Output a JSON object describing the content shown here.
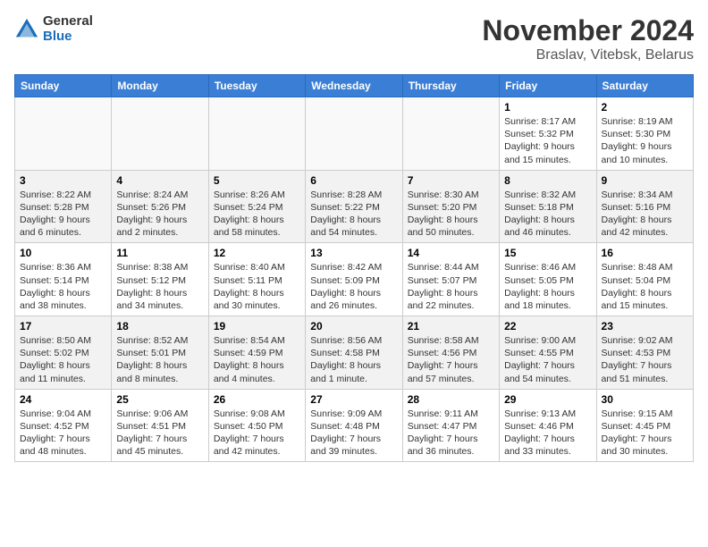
{
  "header": {
    "logo_general": "General",
    "logo_blue": "Blue",
    "month_title": "November 2024",
    "location": "Braslav, Vitebsk, Belarus"
  },
  "days_of_week": [
    "Sunday",
    "Monday",
    "Tuesday",
    "Wednesday",
    "Thursday",
    "Friday",
    "Saturday"
  ],
  "weeks": [
    {
      "shaded": false,
      "days": [
        {
          "num": "",
          "info": ""
        },
        {
          "num": "",
          "info": ""
        },
        {
          "num": "",
          "info": ""
        },
        {
          "num": "",
          "info": ""
        },
        {
          "num": "",
          "info": ""
        },
        {
          "num": "1",
          "info": "Sunrise: 8:17 AM\nSunset: 5:32 PM\nDaylight: 9 hours\nand 15 minutes."
        },
        {
          "num": "2",
          "info": "Sunrise: 8:19 AM\nSunset: 5:30 PM\nDaylight: 9 hours\nand 10 minutes."
        }
      ]
    },
    {
      "shaded": true,
      "days": [
        {
          "num": "3",
          "info": "Sunrise: 8:22 AM\nSunset: 5:28 PM\nDaylight: 9 hours\nand 6 minutes."
        },
        {
          "num": "4",
          "info": "Sunrise: 8:24 AM\nSunset: 5:26 PM\nDaylight: 9 hours\nand 2 minutes."
        },
        {
          "num": "5",
          "info": "Sunrise: 8:26 AM\nSunset: 5:24 PM\nDaylight: 8 hours\nand 58 minutes."
        },
        {
          "num": "6",
          "info": "Sunrise: 8:28 AM\nSunset: 5:22 PM\nDaylight: 8 hours\nand 54 minutes."
        },
        {
          "num": "7",
          "info": "Sunrise: 8:30 AM\nSunset: 5:20 PM\nDaylight: 8 hours\nand 50 minutes."
        },
        {
          "num": "8",
          "info": "Sunrise: 8:32 AM\nSunset: 5:18 PM\nDaylight: 8 hours\nand 46 minutes."
        },
        {
          "num": "9",
          "info": "Sunrise: 8:34 AM\nSunset: 5:16 PM\nDaylight: 8 hours\nand 42 minutes."
        }
      ]
    },
    {
      "shaded": false,
      "days": [
        {
          "num": "10",
          "info": "Sunrise: 8:36 AM\nSunset: 5:14 PM\nDaylight: 8 hours\nand 38 minutes."
        },
        {
          "num": "11",
          "info": "Sunrise: 8:38 AM\nSunset: 5:12 PM\nDaylight: 8 hours\nand 34 minutes."
        },
        {
          "num": "12",
          "info": "Sunrise: 8:40 AM\nSunset: 5:11 PM\nDaylight: 8 hours\nand 30 minutes."
        },
        {
          "num": "13",
          "info": "Sunrise: 8:42 AM\nSunset: 5:09 PM\nDaylight: 8 hours\nand 26 minutes."
        },
        {
          "num": "14",
          "info": "Sunrise: 8:44 AM\nSunset: 5:07 PM\nDaylight: 8 hours\nand 22 minutes."
        },
        {
          "num": "15",
          "info": "Sunrise: 8:46 AM\nSunset: 5:05 PM\nDaylight: 8 hours\nand 18 minutes."
        },
        {
          "num": "16",
          "info": "Sunrise: 8:48 AM\nSunset: 5:04 PM\nDaylight: 8 hours\nand 15 minutes."
        }
      ]
    },
    {
      "shaded": true,
      "days": [
        {
          "num": "17",
          "info": "Sunrise: 8:50 AM\nSunset: 5:02 PM\nDaylight: 8 hours\nand 11 minutes."
        },
        {
          "num": "18",
          "info": "Sunrise: 8:52 AM\nSunset: 5:01 PM\nDaylight: 8 hours\nand 8 minutes."
        },
        {
          "num": "19",
          "info": "Sunrise: 8:54 AM\nSunset: 4:59 PM\nDaylight: 8 hours\nand 4 minutes."
        },
        {
          "num": "20",
          "info": "Sunrise: 8:56 AM\nSunset: 4:58 PM\nDaylight: 8 hours\nand 1 minute."
        },
        {
          "num": "21",
          "info": "Sunrise: 8:58 AM\nSunset: 4:56 PM\nDaylight: 7 hours\nand 57 minutes."
        },
        {
          "num": "22",
          "info": "Sunrise: 9:00 AM\nSunset: 4:55 PM\nDaylight: 7 hours\nand 54 minutes."
        },
        {
          "num": "23",
          "info": "Sunrise: 9:02 AM\nSunset: 4:53 PM\nDaylight: 7 hours\nand 51 minutes."
        }
      ]
    },
    {
      "shaded": false,
      "days": [
        {
          "num": "24",
          "info": "Sunrise: 9:04 AM\nSunset: 4:52 PM\nDaylight: 7 hours\nand 48 minutes."
        },
        {
          "num": "25",
          "info": "Sunrise: 9:06 AM\nSunset: 4:51 PM\nDaylight: 7 hours\nand 45 minutes."
        },
        {
          "num": "26",
          "info": "Sunrise: 9:08 AM\nSunset: 4:50 PM\nDaylight: 7 hours\nand 42 minutes."
        },
        {
          "num": "27",
          "info": "Sunrise: 9:09 AM\nSunset: 4:48 PM\nDaylight: 7 hours\nand 39 minutes."
        },
        {
          "num": "28",
          "info": "Sunrise: 9:11 AM\nSunset: 4:47 PM\nDaylight: 7 hours\nand 36 minutes."
        },
        {
          "num": "29",
          "info": "Sunrise: 9:13 AM\nSunset: 4:46 PM\nDaylight: 7 hours\nand 33 minutes."
        },
        {
          "num": "30",
          "info": "Sunrise: 9:15 AM\nSunset: 4:45 PM\nDaylight: 7 hours\nand 30 minutes."
        }
      ]
    }
  ]
}
